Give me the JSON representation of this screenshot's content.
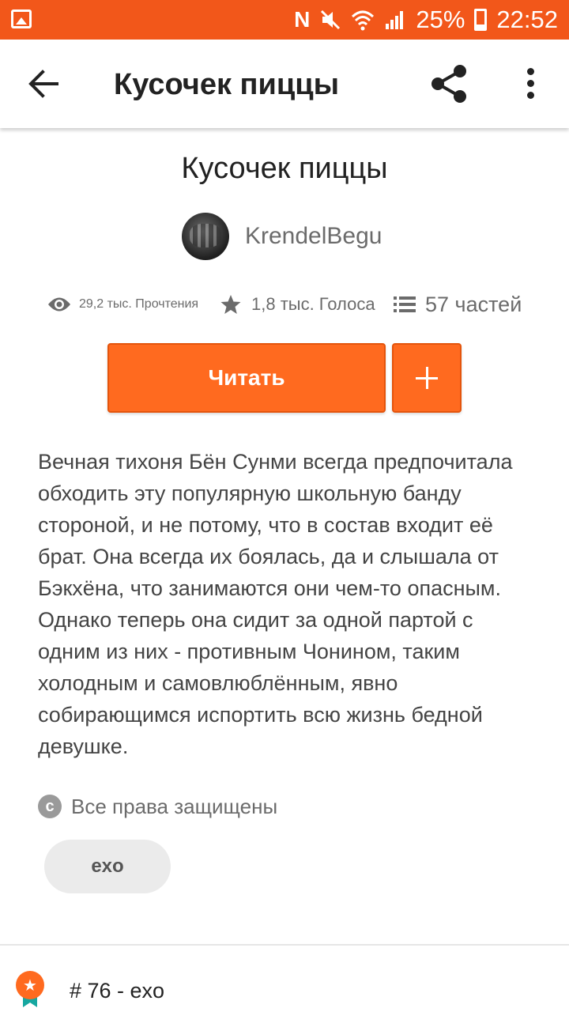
{
  "status_bar": {
    "battery": "25%",
    "time": "22:52",
    "icons": [
      "gallery-icon",
      "nfc-icon",
      "mute-icon",
      "wifi-icon",
      "signal-icon",
      "battery-icon"
    ],
    "background": "#f2571a"
  },
  "app_bar": {
    "title": "Кусочек пиццы",
    "icons": [
      "back-arrow-icon",
      "share-icon",
      "more-vert-icon"
    ]
  },
  "story": {
    "title": "Кусочек пиццы",
    "author": "KrendelBegu",
    "stats": {
      "reads": "29,2 тыс. Прочтения",
      "votes": "1,8 тыс. Голоса",
      "parts": "57 частей"
    },
    "read_button": "Читать",
    "add_button": "+",
    "description": "Вечная тихоня Бён Сунми всегда предпочитала обходить эту популярную школьную банду стороной, и не потому, что в состав входит её брат. Она всегда их боялась, да и слышала от Бэкхёна, что занимаются они чем-то опасным. Однако теперь она сидит за одной партой с одним из них - противным Чонином, таким холодным и самовлюблённым, явно собирающимся испортить всю жизнь бедной девушке.",
    "copyright": "Все права защищены",
    "copyright_symbol": "c",
    "tags": [
      "exo"
    ],
    "ranking": "# 76 - exo",
    "accent": "#ff6a1f"
  }
}
